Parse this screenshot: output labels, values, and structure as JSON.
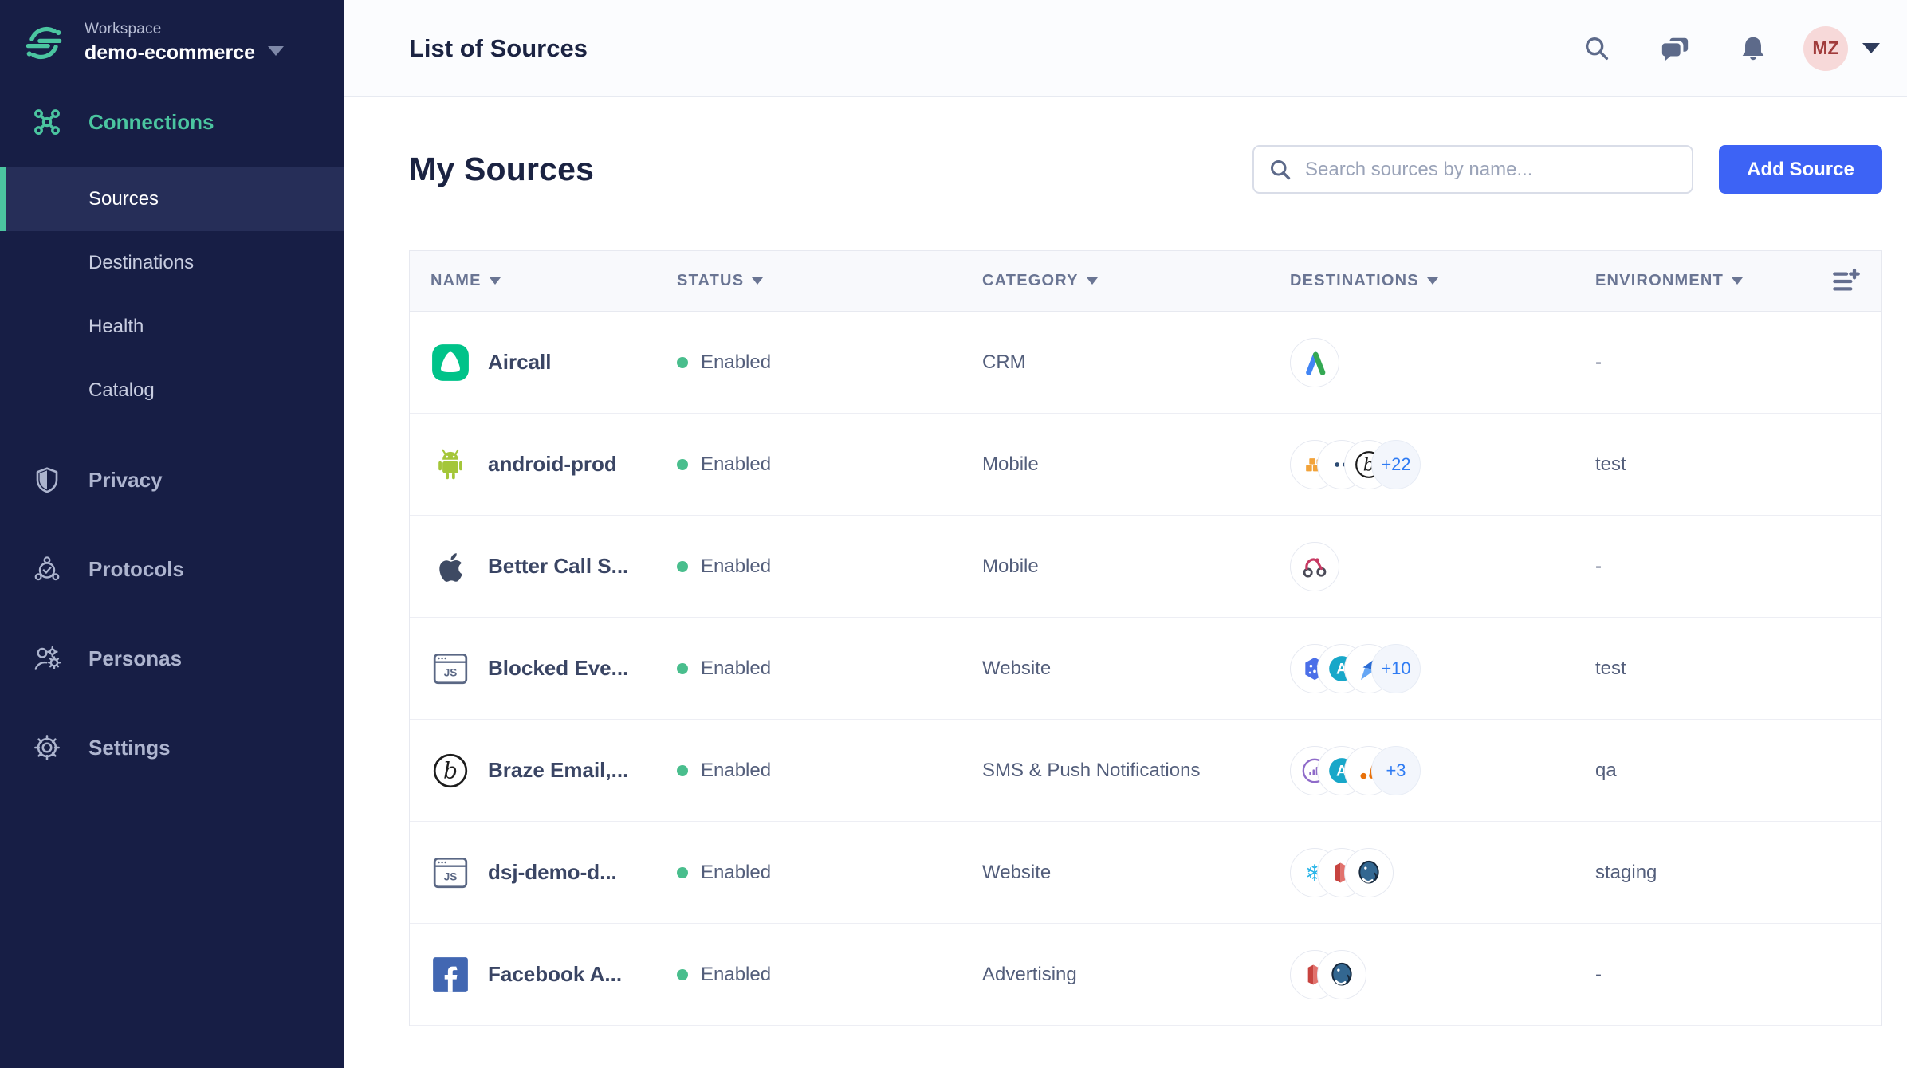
{
  "colors": {
    "sidebar_bg": "#171E45",
    "sidebar_selected_bg": "#262E58",
    "brand_green": "#4BC5A0",
    "accent_blue": "#3D63F5",
    "status_green": "#49BE8D",
    "overflow_blue": "#2E7BF3",
    "avatar_bg": "#F7D9D9",
    "avatar_text": "#A13C3C",
    "header_text": "#6A7593"
  },
  "sidebar": {
    "workspace_label": "Workspace",
    "workspace_name": "demo-ecommerce",
    "nav": {
      "connections": "Connections",
      "sub": [
        "Sources",
        "Destinations",
        "Health",
        "Catalog"
      ],
      "privacy": "Privacy",
      "protocols": "Protocols",
      "personas": "Personas",
      "settings": "Settings"
    }
  },
  "topbar": {
    "title": "List of Sources",
    "avatar_initials": "MZ"
  },
  "page": {
    "title": "My Sources",
    "search_placeholder": "Search sources by name...",
    "add_button": "Add Source"
  },
  "table": {
    "columns": [
      "NAME",
      "STATUS",
      "CATEGORY",
      "DESTINATIONS",
      "ENVIRONMENT"
    ],
    "rows": [
      {
        "name": "Aircall",
        "icon": "aircall-logo",
        "status": "Enabled",
        "category": "CRM",
        "destinations": {
          "icons": [
            "google-adwords"
          ],
          "overflow": null
        },
        "environment": "-"
      },
      {
        "name": "android-prod",
        "icon": "android-logo",
        "status": "Enabled",
        "category": "Mobile",
        "destinations": {
          "icons": [
            "aws-cubes",
            "partial-logo-dots",
            "braze"
          ],
          "overflow": "+22"
        },
        "environment": "test"
      },
      {
        "name": "Better Call S...",
        "icon": "apple-logo",
        "status": "Enabled",
        "category": "Mobile",
        "destinations": {
          "icons": [
            "webhook"
          ],
          "overflow": null
        },
        "environment": "-"
      },
      {
        "name": "Blocked Eve...",
        "icon": "javascript-website",
        "status": "Enabled",
        "category": "Website",
        "destinations": {
          "icons": [
            "blue-hexagon-dots",
            "teal-a",
            "blue-arrow"
          ],
          "overflow": "+10"
        },
        "environment": "test"
      },
      {
        "name": "Braze Email,...",
        "icon": "braze-logo",
        "status": "Enabled",
        "category": "SMS & Push Notifications",
        "destinations": {
          "icons": [
            "amplitude",
            "teal-a",
            "google-analytics"
          ],
          "overflow": "+3"
        },
        "environment": "qa"
      },
      {
        "name": "dsj-demo-d...",
        "icon": "javascript-website",
        "status": "Enabled",
        "category": "Website",
        "destinations": {
          "icons": [
            "snowflake",
            "redshift",
            "postgres"
          ],
          "overflow": null
        },
        "environment": "staging"
      },
      {
        "name": "Facebook A...",
        "icon": "facebook-logo",
        "status": "Enabled",
        "category": "Advertising",
        "destinations": {
          "icons": [
            "redshift",
            "postgres"
          ],
          "overflow": null
        },
        "environment": "-"
      }
    ]
  }
}
